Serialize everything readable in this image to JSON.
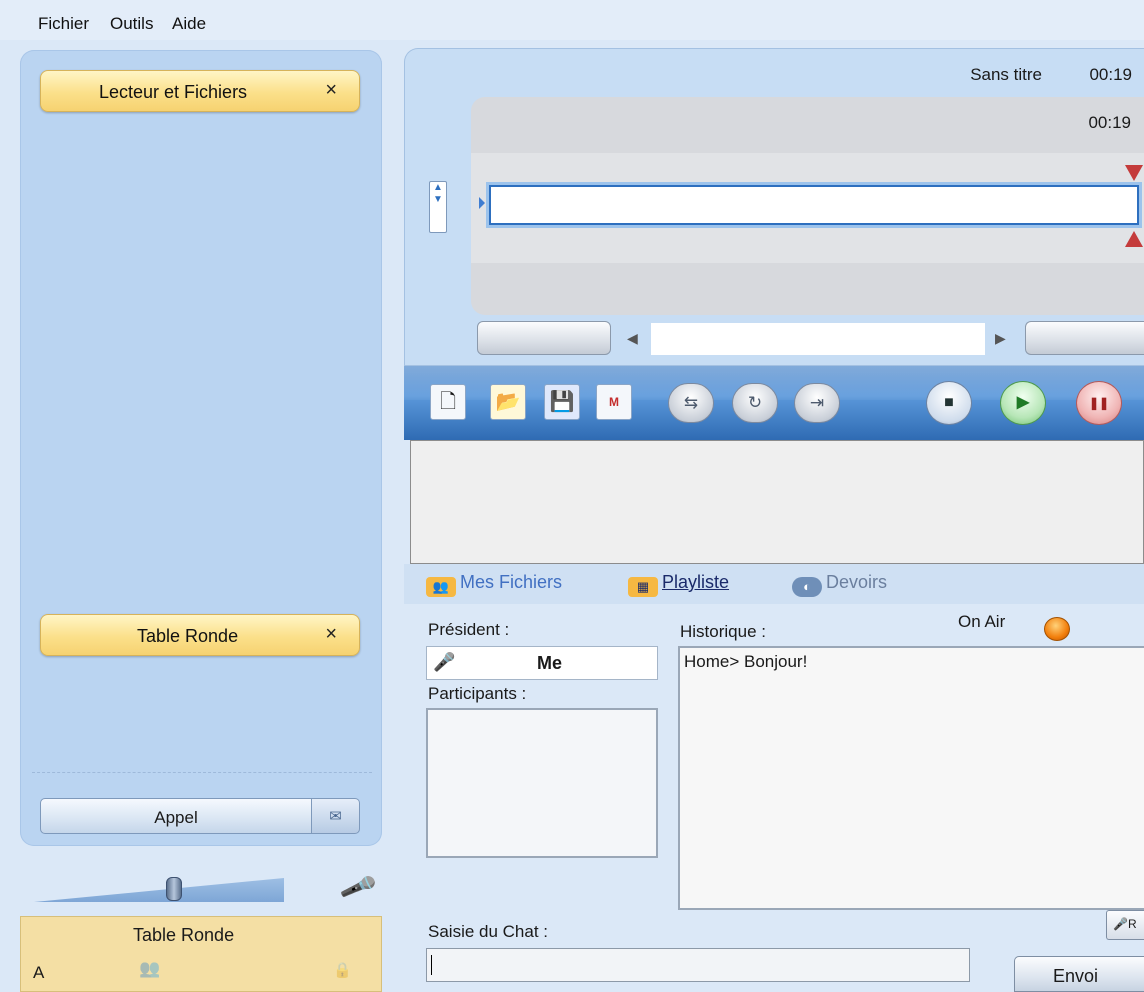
{
  "menu": {
    "items": [
      "Fichier",
      "Outils",
      "Aide"
    ]
  },
  "left_panel": {
    "tab_player": {
      "label": "Lecteur et Fichiers",
      "close": "×"
    },
    "tab_table": {
      "label": "Table Ronde",
      "close": "×"
    },
    "appel_label": "Appel",
    "mail_icon": "✉"
  },
  "volume": {
    "level": 0.56
  },
  "bottom_box": {
    "title": "Table Ronde",
    "letter": "A",
    "group_icon": "👥",
    "lock_icon": "🔒"
  },
  "player": {
    "file_name": "Sans titre",
    "time_total": "00:19",
    "time_position": "00:19"
  },
  "toolbar": {
    "new_icon": "🗋",
    "open_icon": "📂",
    "save_icon": "💾",
    "wave_icon": "M",
    "shuffle_icon": "⇆",
    "repeat_icon": "↻",
    "export_icon": "⇥",
    "stop_icon": "■",
    "play_icon": "▶",
    "pause_icon": "❚❚"
  },
  "tabs": [
    {
      "label": "Mes Fichiers",
      "color": "#4170c2"
    },
    {
      "label": "Playliste",
      "color": "#1a2a6a"
    },
    {
      "label": "Devoirs",
      "color": "#6b7f9e"
    }
  ],
  "chat": {
    "president_label": "Président :",
    "president_value": "Me",
    "participants_label": "Participants :",
    "history_label": "Historique :",
    "history_lines": [
      "Home> Bonjour!"
    ],
    "on_air_label": "On Air",
    "input_label": "Saisie du Chat :",
    "input_value": "",
    "send_label": "Envoi",
    "rec_label": "R"
  },
  "colors": {
    "accent": "#2d6fbf",
    "tab_yellow": "#fbe08a",
    "on_air": "#f27f0c"
  }
}
